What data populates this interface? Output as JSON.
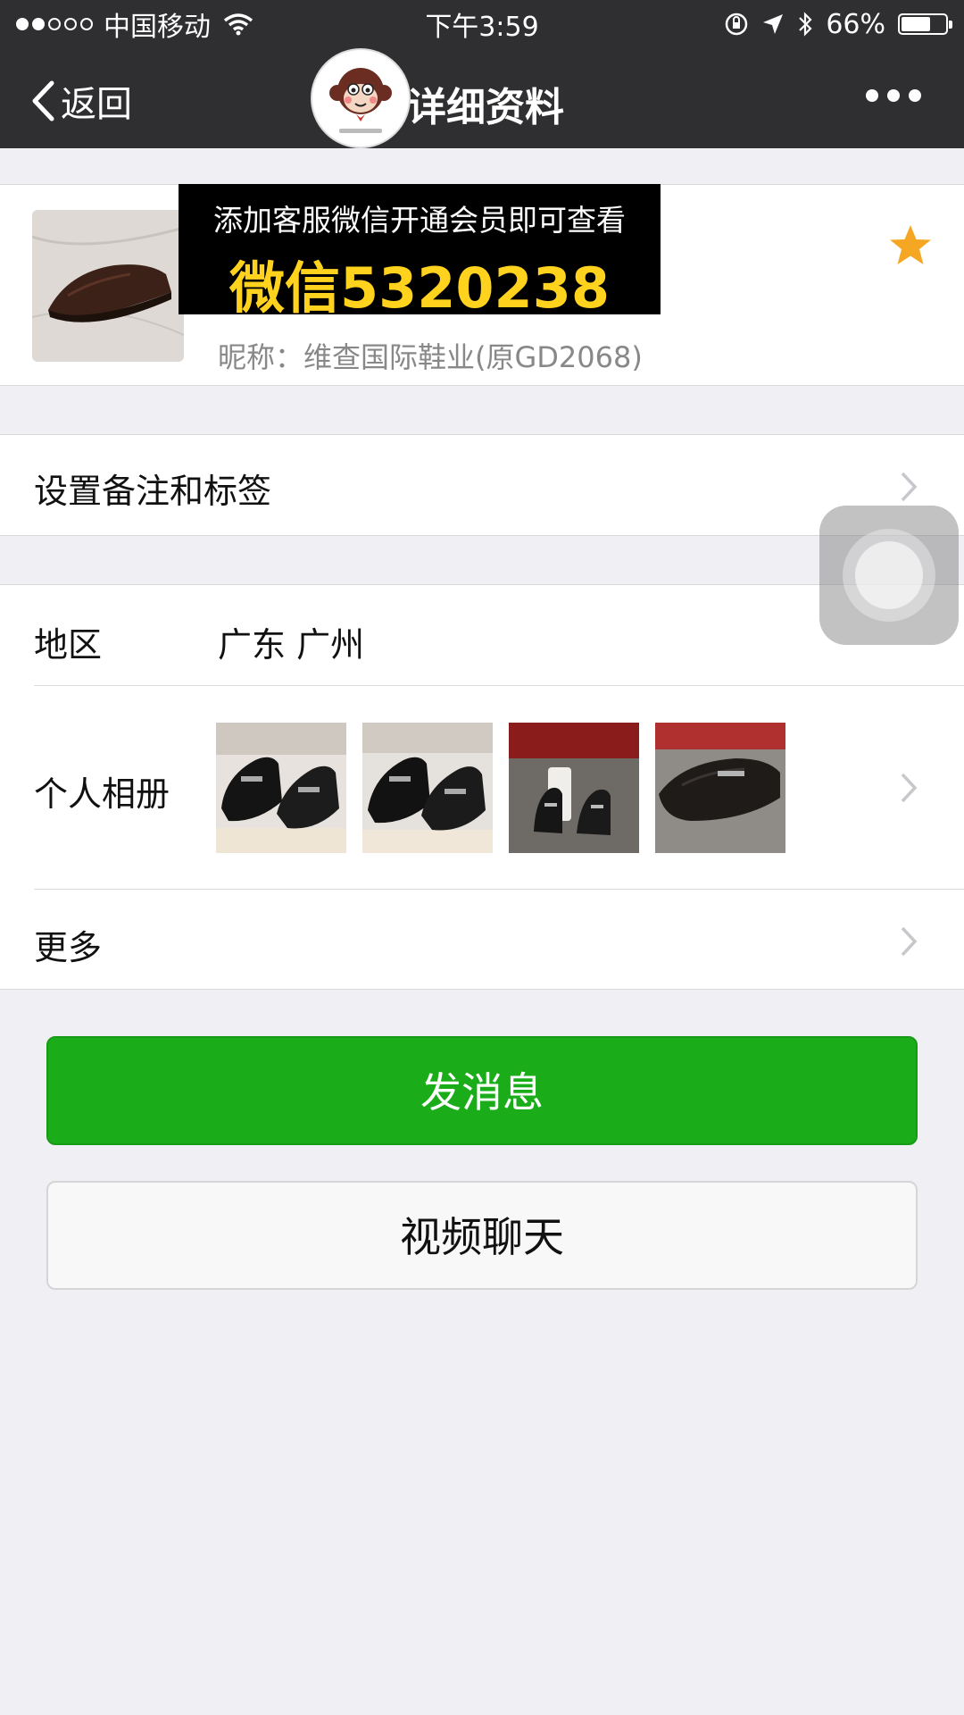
{
  "status": {
    "carrier": "中国移动",
    "time": "下午3:59",
    "battery": "66%",
    "battery_level": 0.66
  },
  "nav": {
    "back_label": "返回",
    "title": "详细资料"
  },
  "banner": {
    "line1": "添加客服微信开通会员即可查看",
    "line2": "微信5320238"
  },
  "profile": {
    "nickname": "昵称：维查国际鞋业(原GD2068)"
  },
  "remark": {
    "label": "设置备注和标签"
  },
  "region": {
    "label": "地区",
    "value": "广东 广州"
  },
  "album": {
    "label": "个人相册",
    "photos": [
      "loafer-photo",
      "loafer-photo",
      "loafer-box-photo",
      "loafer-photo"
    ]
  },
  "more": {
    "label": "更多"
  },
  "buttons": {
    "send": "发消息",
    "video": "视频聊天"
  },
  "colors": {
    "nav_bg": "#2f2f31",
    "send_green": "#1aad19",
    "star": "#f5a623",
    "banner_yellow": "#ffd21e"
  }
}
